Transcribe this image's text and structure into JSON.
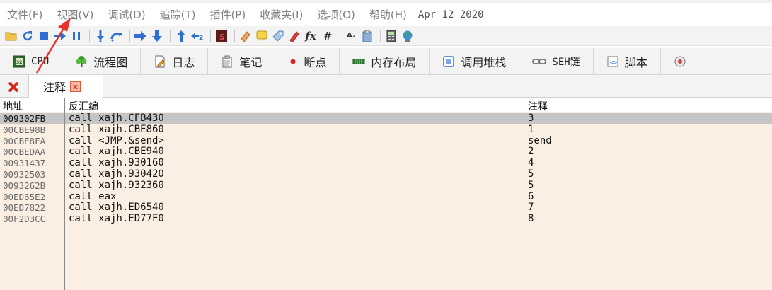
{
  "menu": {
    "items": [
      "文件(F)",
      "视图(V)",
      "调试(D)",
      "追踪(T)",
      "插件(P)",
      "收藏夹(I)",
      "选项(O)",
      "帮助(H)"
    ],
    "date": "Apr 12 2020"
  },
  "toolbar": {
    "fx_label": "fx",
    "hash_label": "#",
    "az_label": "A₂"
  },
  "viewtabs": [
    {
      "label": "CPU",
      "icon": "cpu-icon"
    },
    {
      "label": "流程图",
      "icon": "flowchart-icon"
    },
    {
      "label": "日志",
      "icon": "log-icon"
    },
    {
      "label": "笔记",
      "icon": "notes-icon"
    },
    {
      "label": "断点",
      "icon": "breakpoint-icon"
    },
    {
      "label": "内存布局",
      "icon": "memory-map-icon"
    },
    {
      "label": "调用堆栈",
      "icon": "call-stack-icon"
    },
    {
      "label": "SEH链",
      "icon": "seh-chain-icon"
    },
    {
      "label": "脚本",
      "icon": "script-icon"
    }
  ],
  "subtab": {
    "label": "注释",
    "close_label": "x"
  },
  "table": {
    "headers": {
      "address": "地址",
      "disassembly": "反汇编",
      "comment": "注释"
    },
    "rows": [
      {
        "address": "009302FB",
        "disassembly": "call xajh.CFB430",
        "comment": "3",
        "selected": true
      },
      {
        "address": "00CBE98B",
        "disassembly": "call xajh.CBE860",
        "comment": "1",
        "selected": false
      },
      {
        "address": "00CBE8FA",
        "disassembly": "call <JMP.&send>",
        "comment": "send",
        "selected": false
      },
      {
        "address": "00CBEDAA",
        "disassembly": "call xajh.CBE940",
        "comment": "2",
        "selected": false
      },
      {
        "address": "00931437",
        "disassembly": "call xajh.930160",
        "comment": "4",
        "selected": false
      },
      {
        "address": "00932503",
        "disassembly": "call xajh.930420",
        "comment": "5",
        "selected": false
      },
      {
        "address": "0093262B",
        "disassembly": "call xajh.932360",
        "comment": "5",
        "selected": false
      },
      {
        "address": "00ED65E2",
        "disassembly": "call eax",
        "comment": "6",
        "selected": false
      },
      {
        "address": "00ED7822",
        "disassembly": "call xajh.ED6540",
        "comment": "7",
        "selected": false
      },
      {
        "address": "00F2D3CC",
        "disassembly": "call xajh.ED77F0",
        "comment": "8",
        "selected": false
      }
    ]
  },
  "colors": {
    "row_background": "#fbefe4",
    "selected_row": "#c5c5c5",
    "annotation_arrow": "#e8322a"
  }
}
